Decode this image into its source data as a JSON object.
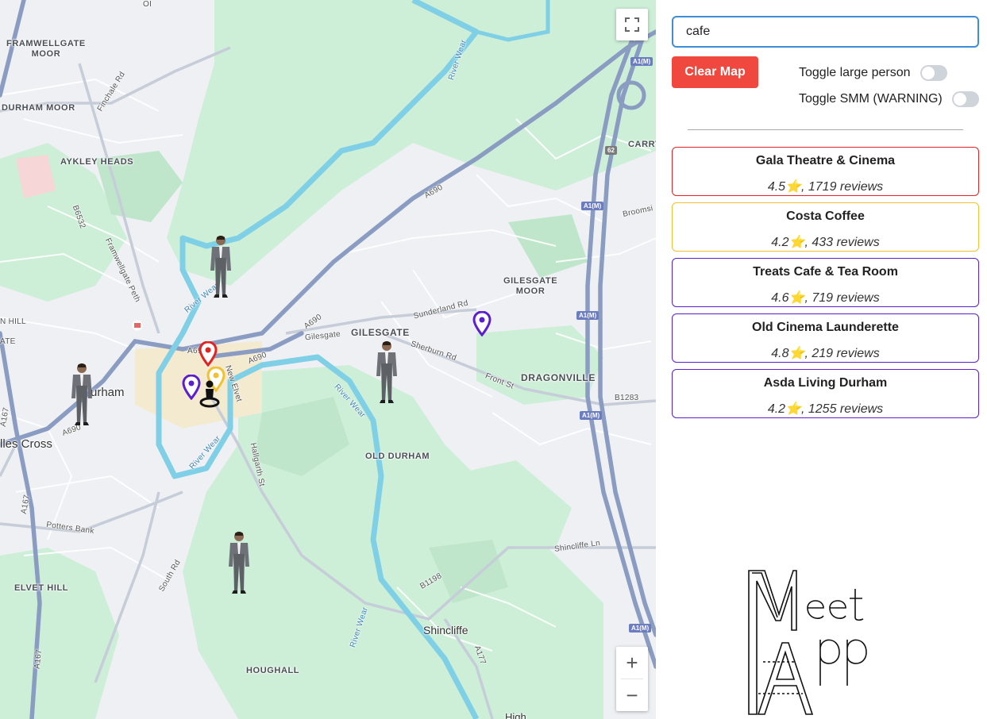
{
  "map": {
    "labels": {
      "framwellgate_moor": "FRAMWELLGATE\nMOOR",
      "durham_moor": "DURHAM MOOR",
      "aykley_heads": "AYKLEY HEADS",
      "carrville": "CARRV",
      "gilesgate_moor": "GILESGATE\nMOOR",
      "gilesgate": "GILESGATE",
      "dragonville": "DRAGONVILLE",
      "old_durham": "OLD DURHAM",
      "durham": "urham",
      "nevilles_cross": "lles Cross",
      "elvet_hill": "ELVET HILL",
      "shincliffe": "Shincliffe",
      "houghall": "HOUGHALL",
      "high": "High",
      "n_hill": "N HILL",
      "ate": "ATE",
      "ol": "OI",
      "finchale_rd": "Finchale Rd",
      "framwellgate_peth": "Framwellgate Peth",
      "a690_1": "A690",
      "a690_2": "A690",
      "a690_3": "A690",
      "a690_4": "A690",
      "a690_5": "A690",
      "gilesgate_rd": "Gilesgate",
      "sunderland_rd": "Sunderland Rd",
      "sherburn_rd": "Sherburn Rd",
      "front_st": "Front St",
      "b1283": "B1283",
      "broomside": "Broomsi",
      "potters_bank": "Potters Bank",
      "south_rd": "South Rd",
      "hallgarth_st": "Hallgarth St",
      "new_elvet": "New Elvet",
      "shincliffe_ln": "Shincliffe Ln",
      "b1198": "B1198",
      "a177": "A177",
      "a167_1": "A167",
      "a167_2": "A167",
      "a167_3": "A167",
      "b6532": "B6532",
      "river_wear_1": "River Wear",
      "river_wear_2": "River Wear",
      "river_wear_3": "River Wear",
      "river_wear_4": "River Wear",
      "river_wear_5": "River Wear",
      "a1m_1": "A1(M)",
      "a1m_2": "A1(M)",
      "a1m_3": "A1(M)",
      "a1m_4": "A1(M)",
      "a1m_5": "A1(M)",
      "shield_62": "62"
    },
    "controls": {
      "zoom_in": "+",
      "zoom_out": "−"
    }
  },
  "search": {
    "value": "cafe",
    "placeholder": ""
  },
  "clear_button": "Clear Map",
  "toggles": [
    {
      "label": "Toggle large person",
      "on": false
    },
    {
      "label": "Toggle SMM (WARNING)",
      "on": false
    }
  ],
  "results": [
    {
      "name": "Gala Theatre & Cinema",
      "meta": "4.5⭐, 1719 reviews",
      "color": "#e02424"
    },
    {
      "name": "Costa Coffee",
      "meta": "4.2⭐, 433 reviews",
      "color": "#f2c030"
    },
    {
      "name": "Treats Cafe & Tea Room",
      "meta": "4.6⭐, 719 reviews",
      "color": "#5b1fd0"
    },
    {
      "name": "Old Cinema Launderette",
      "meta": "4.8⭐, 219 reviews",
      "color": "#5b1fd0"
    },
    {
      "name": "Asda Living Durham",
      "meta": "4.2⭐, 1255 reviews",
      "color": "#5b1fd0"
    }
  ],
  "logo_text": "Meet App"
}
